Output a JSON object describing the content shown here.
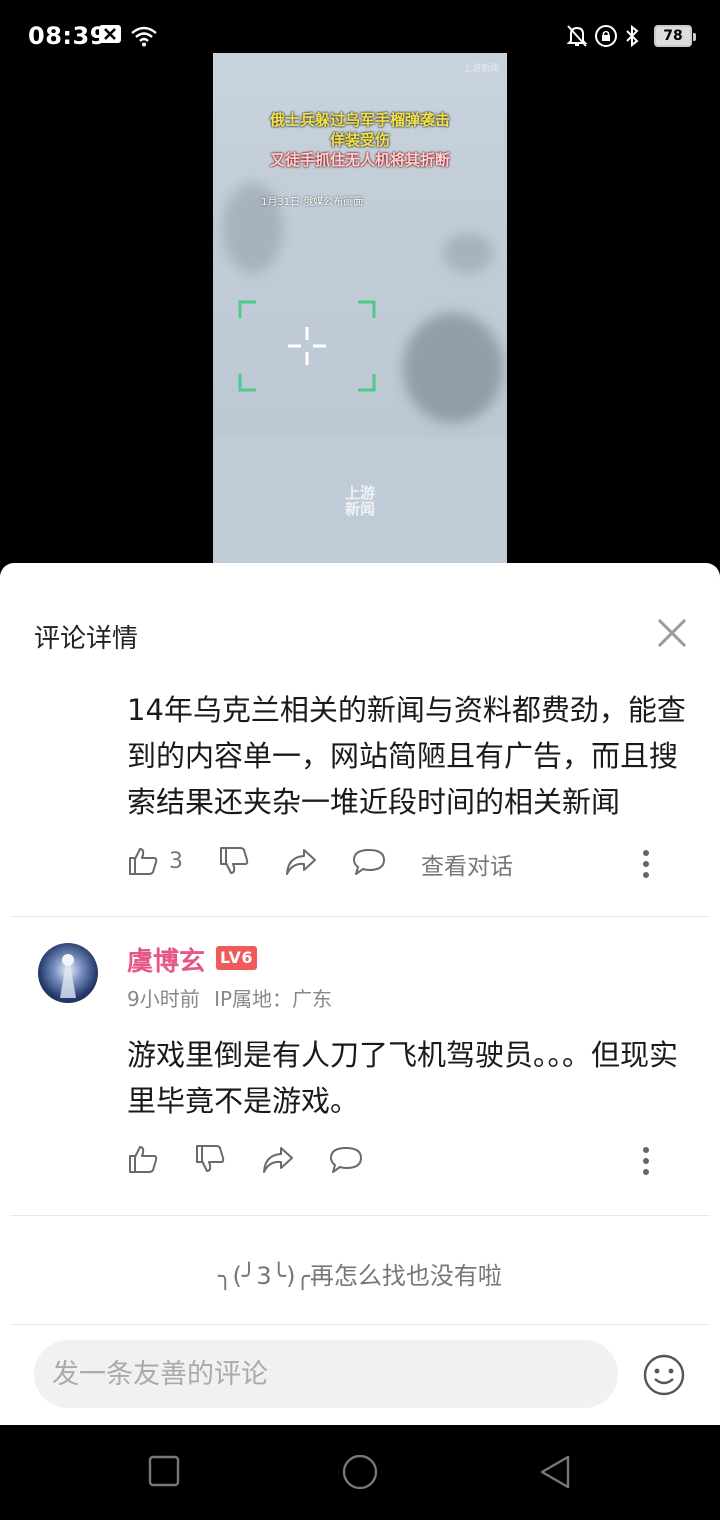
{
  "status_bar": {
    "time": "08:39",
    "battery": "78"
  },
  "video": {
    "caption_line1": "俄士兵躲过乌军手榴弹袭击",
    "caption_line2": "佯装受伤",
    "caption_line3": "又徒手抓住无人机将其折断",
    "date_note": "1月31日 俄媒公布画面",
    "logo": "上游新闻",
    "watermark_line1": "上游",
    "watermark_line2": "新闻"
  },
  "panel": {
    "title": "评论详情"
  },
  "comment1": {
    "text": "14年乌克兰相关的新闻与资料都费劲，能查到的内容单一，网站简陋且有广告，而且搜索结果还夹杂一堆近段时间的相关新闻",
    "like_count": "3",
    "view_conversation": "查看对话"
  },
  "comment2": {
    "username": "虞博玄",
    "level": "LV6",
    "time": "9小时前",
    "ip_location": "IP属地：广东",
    "text": "游戏里倒是有人刀了飞机驾驶员。。。但现实里毕竟不是游戏。"
  },
  "end_message": "╮(╯3╰)╭再怎么找也没有啦",
  "comment_input": {
    "placeholder": "发一条友善的评论"
  },
  "colors": {
    "username": "#e5578a",
    "level_badge": "#f05a5a"
  }
}
